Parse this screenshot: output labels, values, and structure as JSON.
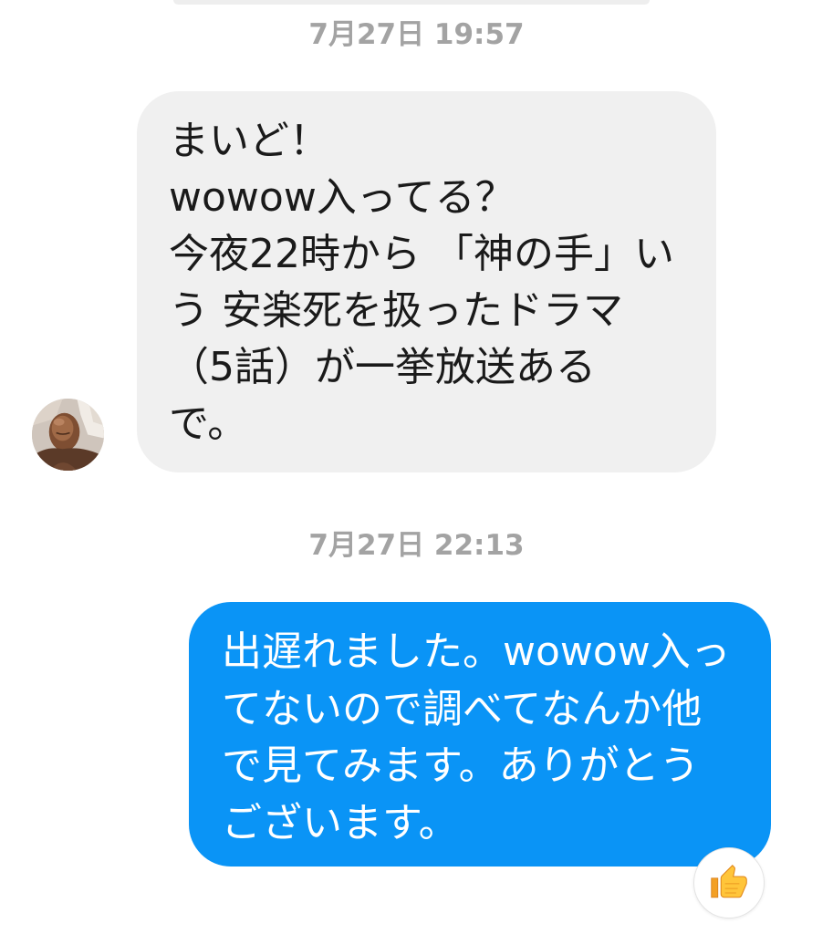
{
  "colors": {
    "incoming_bubble": "#f0f0f0",
    "incoming_text": "#1a1a1a",
    "outgoing_bubble": "#0a94f6",
    "outgoing_text": "#ffffff",
    "timestamp": "#a3a3a3"
  },
  "thread": {
    "timestamp_1": "7月27日 19:57",
    "incoming_message": {
      "lines": [
        "まいど！",
        "wowow入ってる？",
        "今夜22時から 「神の手」い",
        "う 安楽死を扱ったドラマ",
        "（5話）が一挙放送ある",
        "で。"
      ]
    },
    "timestamp_2": "7月27日 22:13",
    "outgoing_message": {
      "lines": [
        "出遅れました。wowow入っ",
        "てないので調べてなんか他",
        "で見てみます。ありがとう",
        "ございます。"
      ],
      "reaction": {
        "icon": "thumbs-up"
      }
    }
  }
}
